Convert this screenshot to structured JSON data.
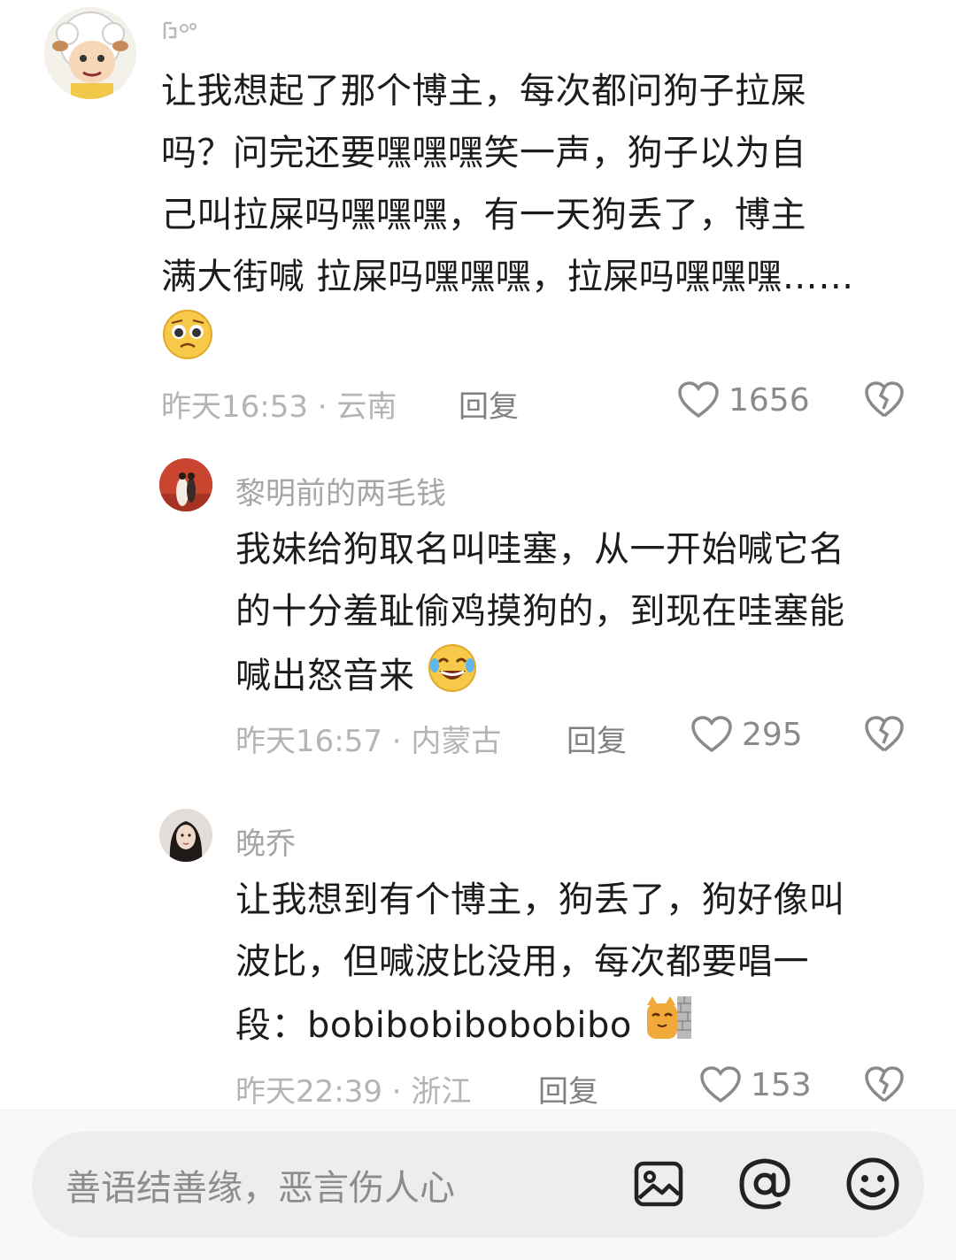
{
  "comments": [
    {
      "username": "",
      "text": "让我想起了那个博主，每次都问狗子拉屎吗？问完还要嘿嘿嘿笑一声，狗子以为自己叫拉屎吗嘿嘿嘿，有一天狗丢了，博主满大街喊 拉屎吗嘿嘿嘿，拉屎吗嘿嘿嘿……",
      "lines": [
        "让我想起了那个博主，每次都问狗子拉屎",
        "吗？问完还要嘿嘿嘿笑一声，狗子以为自",
        "己叫拉屎吗嘿嘿嘿，有一天狗丢了，博主",
        "满大街喊 拉屎吗嘿嘿嘿，拉屎吗嘿嘿嘿……"
      ],
      "emoji": "pleading-face-icon",
      "meta": "昨天16:53 · 云南",
      "reply": "回复",
      "likes": "1656"
    },
    {
      "username": "黎明前的两毛钱",
      "lines": [
        "我妹给狗取名叫哇塞，从一开始喊它名",
        "的十分羞耻偷鸡摸狗的，到现在哇塞能",
        "喊出怒音来"
      ],
      "emoji": "laugh-cry-icon",
      "meta": "昨天16:57 · 内蒙古",
      "reply": "回复",
      "likes": "295"
    },
    {
      "username": "晚乔",
      "lines": [
        "让我想到有个博主，狗丢了，狗好像叫",
        "波比，但喊波比没用，每次都要唱一",
        "段：bobibobibobobibo"
      ],
      "emoji": "cat-peek-icon",
      "meta": "昨天22:39 · 浙江",
      "reply": "回复",
      "likes": "153"
    }
  ],
  "input": {
    "placeholder": "善语结善缘，恶言伤人心"
  },
  "colors": {
    "meta": "#b4b4b4",
    "text": "#1c1c1c",
    "accent": "#f5c542"
  }
}
